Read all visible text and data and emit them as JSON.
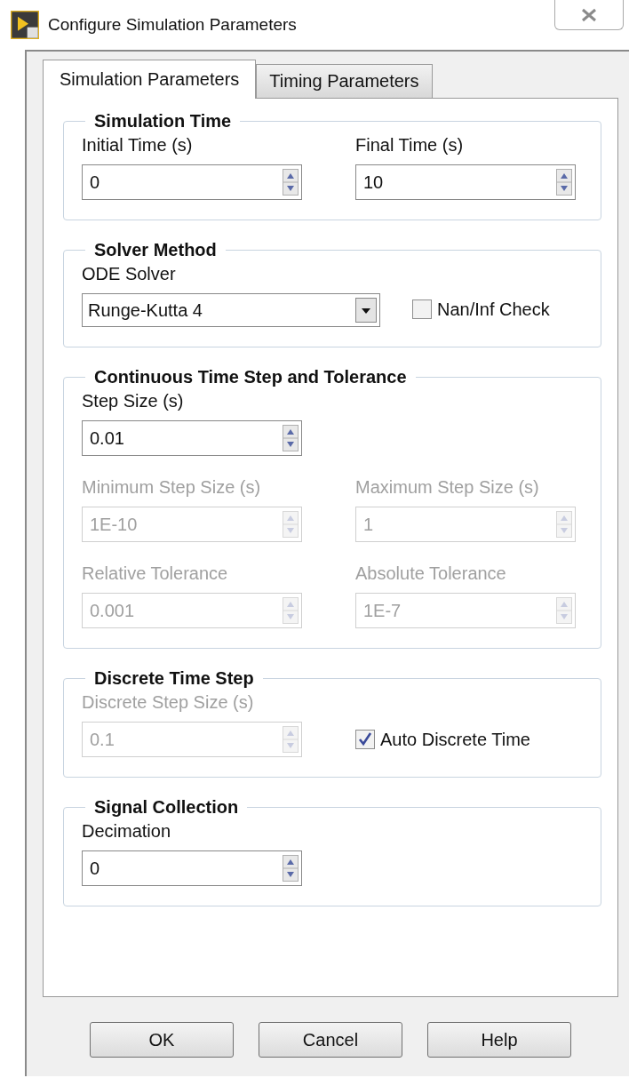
{
  "window": {
    "title": "Configure Simulation Parameters"
  },
  "tabs": [
    {
      "label": "Simulation Parameters",
      "selected": true
    },
    {
      "label": "Timing Parameters",
      "selected": false
    }
  ],
  "groups": [
    {
      "title": "Simulation Time",
      "rows": [
        [
          {
            "kind": "numeric",
            "label": "Initial Time (s)",
            "value": "0",
            "disabled": false
          },
          {
            "kind": "numeric",
            "label": "Final Time (s)",
            "value": "10",
            "disabled": false
          }
        ]
      ]
    },
    {
      "title": "Solver Method",
      "rows": [
        [
          {
            "kind": "dropdown",
            "label": "ODE Solver",
            "value": "Runge-Kutta 4"
          },
          {
            "kind": "checkbox",
            "label": "Nan/Inf Check",
            "checked": false
          }
        ]
      ]
    },
    {
      "title": "Continuous Time Step and Tolerance",
      "rows": [
        [
          {
            "kind": "numeric",
            "label": "Step Size (s)",
            "value": "0.01",
            "disabled": false
          }
        ],
        [
          {
            "kind": "numeric",
            "label": "Minimum Step Size (s)",
            "value": "1E-10",
            "disabled": true
          },
          {
            "kind": "numeric",
            "label": "Maximum Step Size (s)",
            "value": "1",
            "disabled": true
          }
        ],
        [
          {
            "kind": "numeric",
            "label": "Relative Tolerance",
            "value": "0.001",
            "disabled": true
          },
          {
            "kind": "numeric",
            "label": "Absolute Tolerance",
            "value": "1E-7",
            "disabled": true
          }
        ]
      ]
    },
    {
      "title": "Discrete Time Step",
      "rows": [
        [
          {
            "kind": "numeric",
            "label": "Discrete Step Size (s)",
            "value": "0.1",
            "disabled": true
          },
          {
            "kind": "checkbox",
            "label": "Auto Discrete Time",
            "checked": true
          }
        ]
      ]
    },
    {
      "title": "Signal Collection",
      "rows": [
        [
          {
            "kind": "numeric",
            "label": "Decimation",
            "value": "0",
            "disabled": false
          }
        ]
      ]
    }
  ],
  "buttons": [
    "OK",
    "Cancel",
    "Help"
  ]
}
